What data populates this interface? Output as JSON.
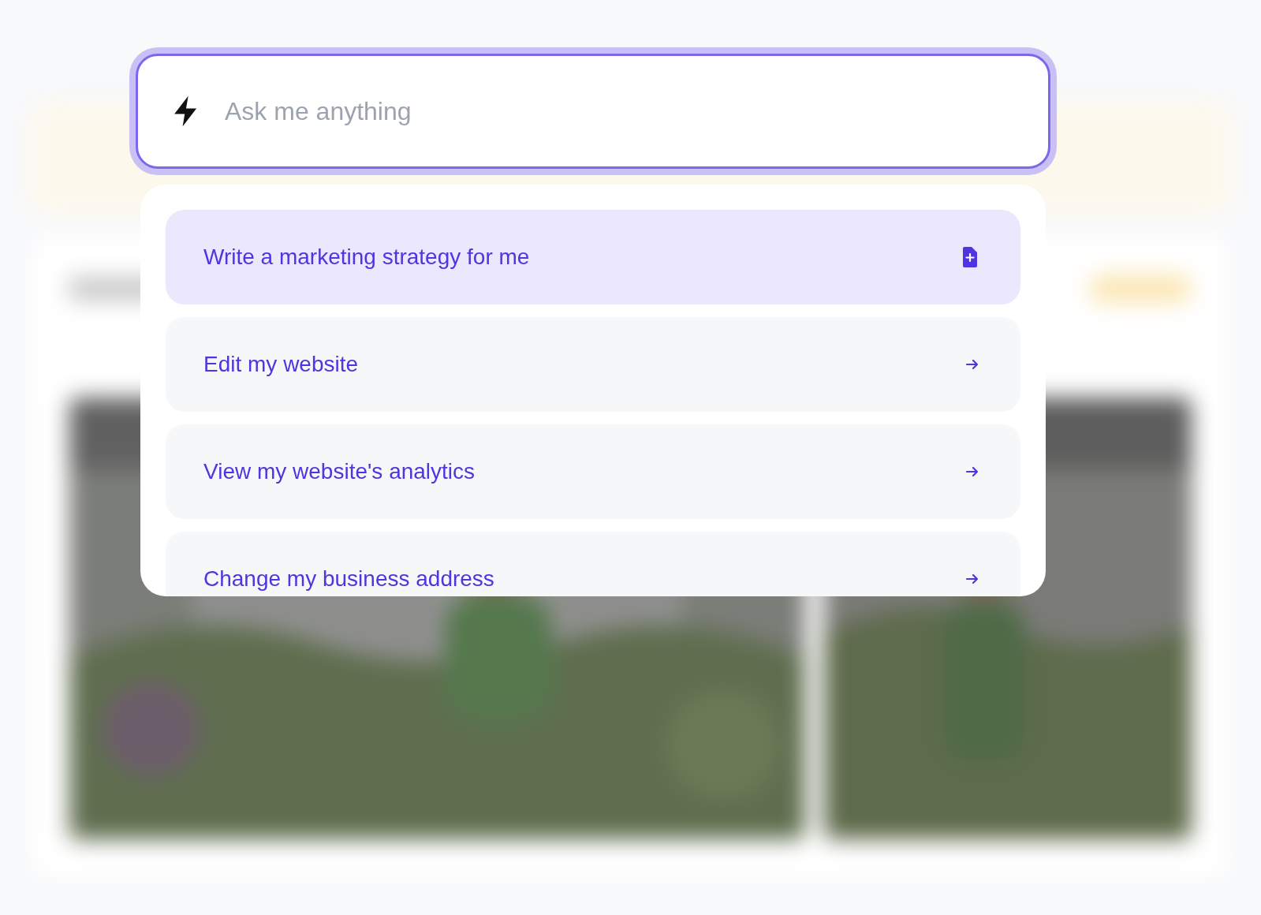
{
  "search": {
    "placeholder": "Ask me anything"
  },
  "suggestions": [
    {
      "label": "Write a marketing strategy for me",
      "kind": "new-document",
      "selected": true
    },
    {
      "label": "Edit my website",
      "kind": "arrow",
      "selected": false
    },
    {
      "label": "View my website's analytics",
      "kind": "arrow",
      "selected": false
    },
    {
      "label": "Change my business address",
      "kind": "arrow",
      "selected": false
    }
  ]
}
